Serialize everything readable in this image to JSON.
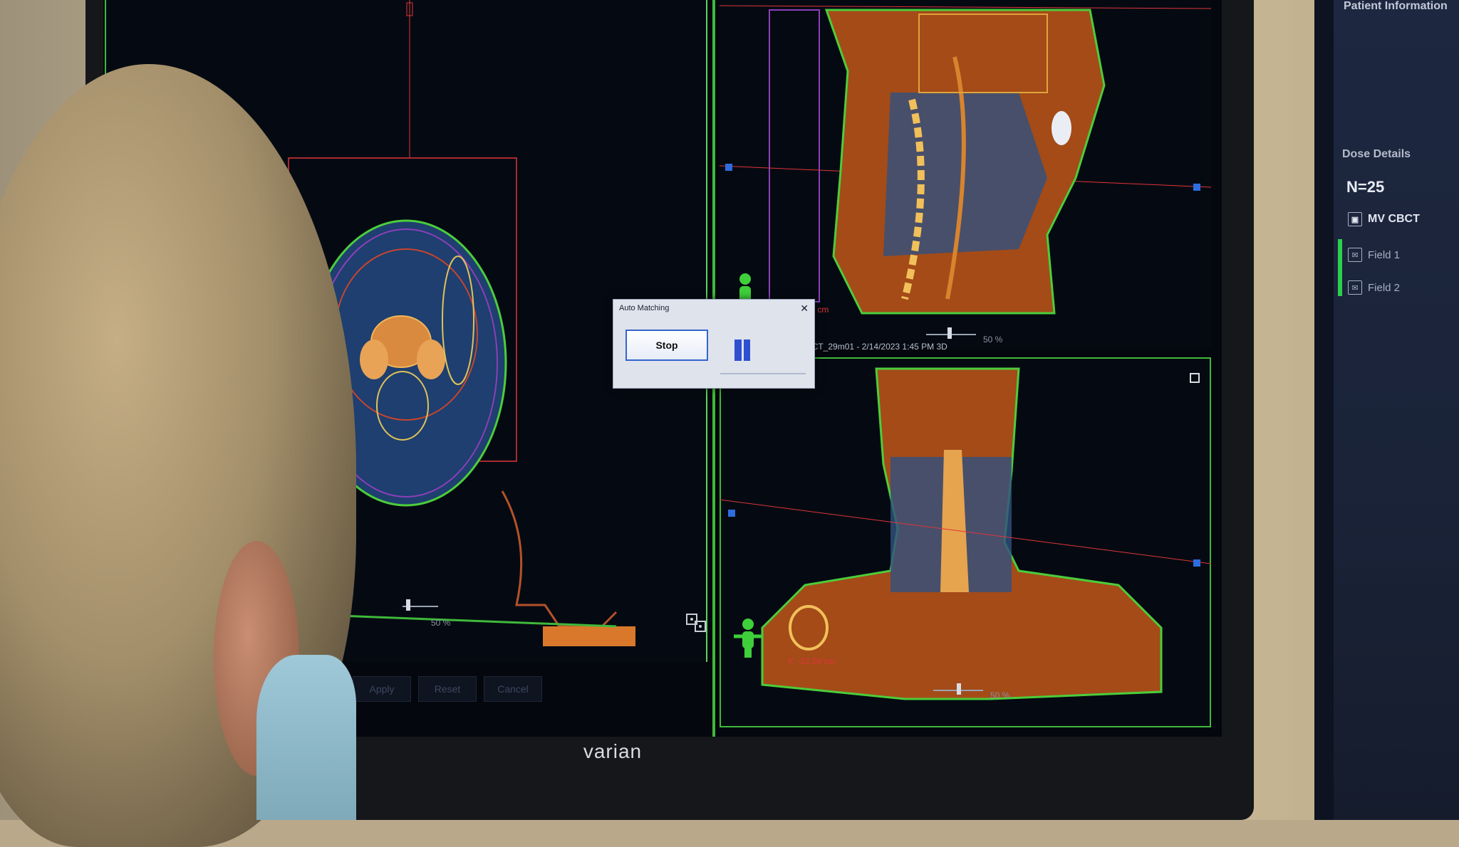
{
  "app": {
    "monitor_brand": "varian"
  },
  "viewports": {
    "axial": {
      "scale_label": "50 %"
    },
    "sagittal": {
      "shift_label": "X: -4.22 cm",
      "scale_label": "50 %"
    },
    "frontal": {
      "title": "Frontal - CT_1 - MVCBCT_29m01 - 2/14/2023 1:45 PM 3D",
      "shift_label": "Y: -22.04 cm",
      "scale_label": "50 %"
    }
  },
  "dialog": {
    "title": "Auto Matching",
    "stop_label": "Stop"
  },
  "button_bar": {
    "apply_label": "Apply",
    "reset_label": "Reset",
    "cancel_label": "Cancel"
  },
  "side_panel": {
    "header": "Patient Information",
    "section_title": "Dose Details",
    "count": "N=25",
    "items": [
      {
        "label": "MV CBCT",
        "icon": "image-icon"
      },
      {
        "label": "Field 1",
        "icon": "field-icon"
      },
      {
        "label": "Field 2",
        "icon": "field-icon"
      }
    ]
  },
  "colors": {
    "viewport_border": "#3fb93a",
    "registration_line": "#e0353b",
    "dialog_button_border": "#3366cc",
    "status_green": "#2bd14a"
  }
}
